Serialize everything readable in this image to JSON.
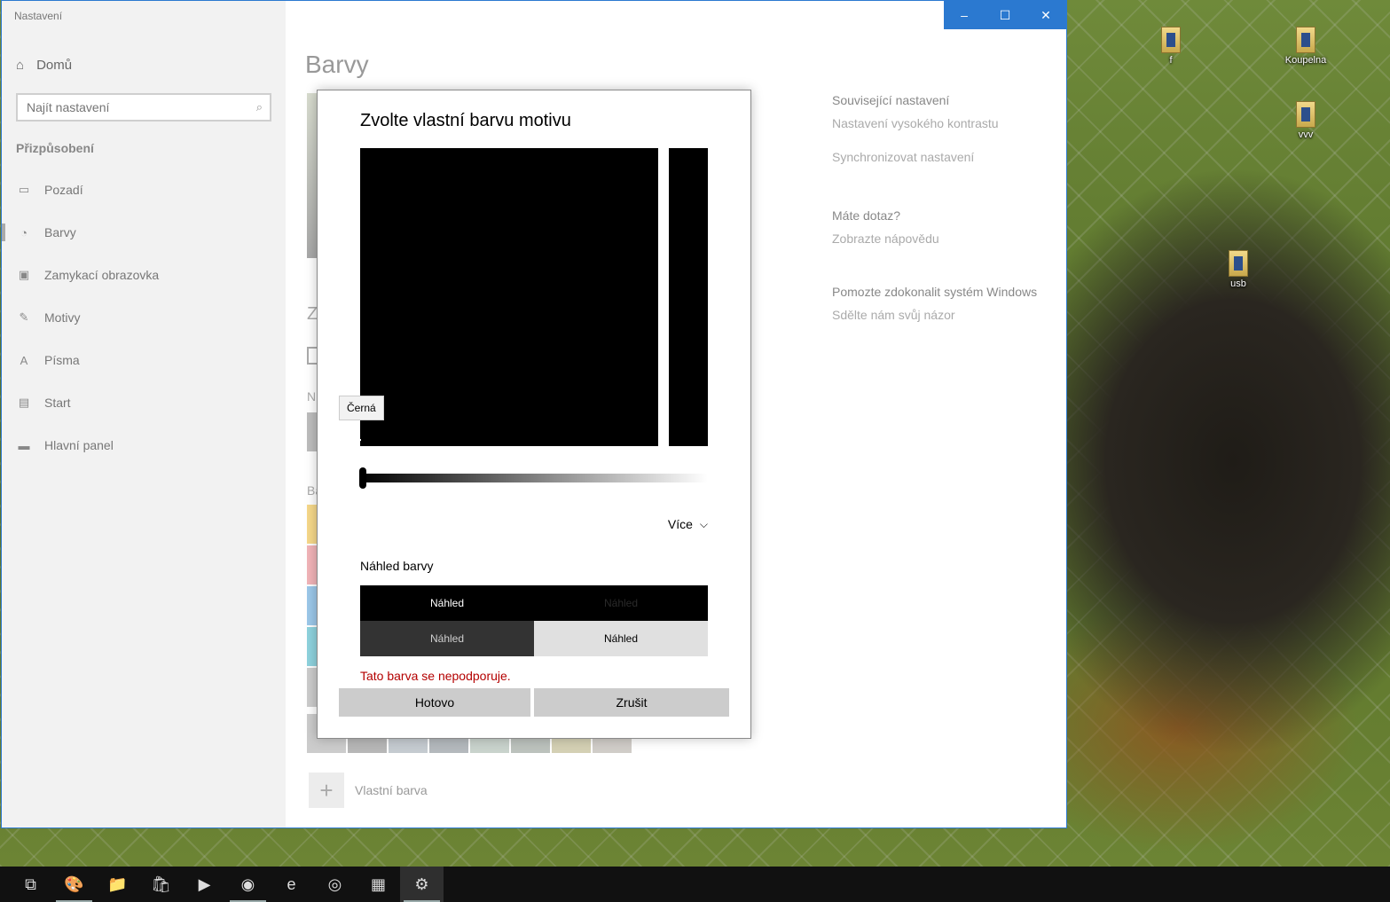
{
  "window": {
    "title": "Nastavení",
    "controls": {
      "minimize": "–",
      "maximize": "☐",
      "close": "✕"
    }
  },
  "sidebar": {
    "home": {
      "label": "Domů",
      "icon": "home-icon"
    },
    "search": {
      "placeholder": "Najít nastavení",
      "icon": "search-icon"
    },
    "section_title": "Přizpůsobení",
    "items": [
      {
        "label": "Pozadí",
        "icon": "image-icon",
        "active": false
      },
      {
        "label": "Barvy",
        "icon": "palette-icon",
        "active": true
      },
      {
        "label": "Zamykací obrazovka",
        "icon": "lock-screen-icon",
        "active": false
      },
      {
        "label": "Motivy",
        "icon": "themes-icon",
        "active": false
      },
      {
        "label": "Písma",
        "icon": "fonts-icon",
        "active": false
      },
      {
        "label": "Start",
        "icon": "start-icon",
        "active": false
      },
      {
        "label": "Hlavní panel",
        "icon": "taskbar-icon",
        "active": false
      }
    ]
  },
  "main": {
    "page_title": "Barvy",
    "partial_labels": {
      "z": "Z",
      "n": "N",
      "ba": "Ba"
    },
    "custom_color": {
      "label": "Vlastní barva",
      "icon": "plus-icon"
    },
    "swatch_colors": [
      "#cccccc",
      "#b7b7b7",
      "#c5cbd0",
      "#b4b9bd",
      "#c9d3cc",
      "#bcc2bd",
      "#d4d0b4",
      "#d0cdc8"
    ],
    "accent_strip_colors": [
      "#f6d88a",
      "#f1b4b8",
      "#9cc8ea",
      "#8fd3de",
      "#cccccc",
      "#cccccc"
    ]
  },
  "related": {
    "heading": "Související nastavení",
    "links": [
      "Nastavení vysokého kontrastu",
      "Synchronizovat nastavení"
    ],
    "question_heading": "Máte dotaz?",
    "help_link": "Zobrazte nápovědu",
    "improve_heading": "Pomozte zdokonalit systém Windows",
    "feedback_link": "Sdělte nám svůj názor"
  },
  "dialog": {
    "title": "Zvolte vlastní barvu motivu",
    "tooltip": "Černá",
    "more_label": "Více",
    "preview_title": "Náhled barvy",
    "preview_cells": [
      {
        "label": "Náhled",
        "bg": "#000000",
        "fg": "#ffffff"
      },
      {
        "label": "Náhled",
        "bg": "#000000",
        "fg": "#2a2a2a"
      },
      {
        "label": "Náhled",
        "bg": "#333333",
        "fg": "#cfcfcf"
      },
      {
        "label": "Náhled",
        "bg": "#e0e0e0",
        "fg": "#000000"
      }
    ],
    "error": "Tato barva se nepodporuje.",
    "done_label": "Hotovo",
    "cancel_label": "Zrušit",
    "selected_color": "#000000",
    "brightness_level": 0
  },
  "desktop_icons": [
    {
      "label": "f"
    },
    {
      "label": "Koupelna"
    },
    {
      "label": "vvv"
    },
    {
      "label": "usb"
    }
  ],
  "taskbar": {
    "items": [
      {
        "icon": "task-view-icon",
        "glyph": "⧉",
        "running": false,
        "active": false
      },
      {
        "icon": "paint-icon",
        "glyph": "🎨",
        "running": true,
        "active": false
      },
      {
        "icon": "file-explorer-icon",
        "glyph": "📁",
        "running": false,
        "active": false
      },
      {
        "icon": "store-icon",
        "glyph": "🛍",
        "running": false,
        "active": false
      },
      {
        "icon": "media-player-icon",
        "glyph": "▶",
        "running": false,
        "active": false
      },
      {
        "icon": "firefox-icon",
        "glyph": "◉",
        "running": true,
        "active": false
      },
      {
        "icon": "internet-explorer-icon",
        "glyph": "e",
        "running": false,
        "active": false
      },
      {
        "icon": "chrome-icon",
        "glyph": "◎",
        "running": false,
        "active": false
      },
      {
        "icon": "calculator-icon",
        "glyph": "▦",
        "running": false,
        "active": false
      },
      {
        "icon": "settings-icon",
        "glyph": "⚙",
        "running": true,
        "active": true
      }
    ]
  }
}
